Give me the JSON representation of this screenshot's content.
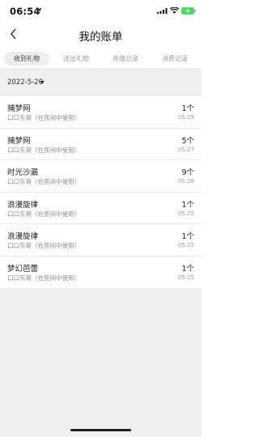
{
  "status": {
    "time": "06:54"
  },
  "nav": {
    "title": "我的账单"
  },
  "tabs": [
    {
      "label": "收到礼物",
      "active": true
    },
    {
      "label": "送出礼物",
      "active": false
    },
    {
      "label": "充值记录",
      "active": false
    },
    {
      "label": "消费记录",
      "active": false
    }
  ],
  "filter": {
    "date": "2022-5-20"
  },
  "records": [
    {
      "gift": "捕梦网",
      "sender": "口口东哥",
      "note": "（在房间中使用）",
      "qty": "1个",
      "time": "05:29"
    },
    {
      "gift": "捕梦网",
      "sender": "口口东哥",
      "note": "（在房间中使用）",
      "qty": "5个",
      "time": "05:27"
    },
    {
      "gift": "时光沙漏",
      "sender": "口口东哥",
      "note": "（在房间中使用）",
      "qty": "9个",
      "time": "05:26"
    },
    {
      "gift": "浪漫旋律",
      "sender": "口口东哥",
      "note": "（在房间中使用）",
      "qty": "1个",
      "time": "05:25"
    },
    {
      "gift": "浪漫旋律",
      "sender": "口口东哥",
      "note": "（在房间中使用）",
      "qty": "1个",
      "time": "05:25"
    },
    {
      "gift": "梦幻芭蕾",
      "sender": "口口东哥",
      "note": "（在房间中使用）",
      "qty": "1个",
      "time": "05:25"
    }
  ]
}
